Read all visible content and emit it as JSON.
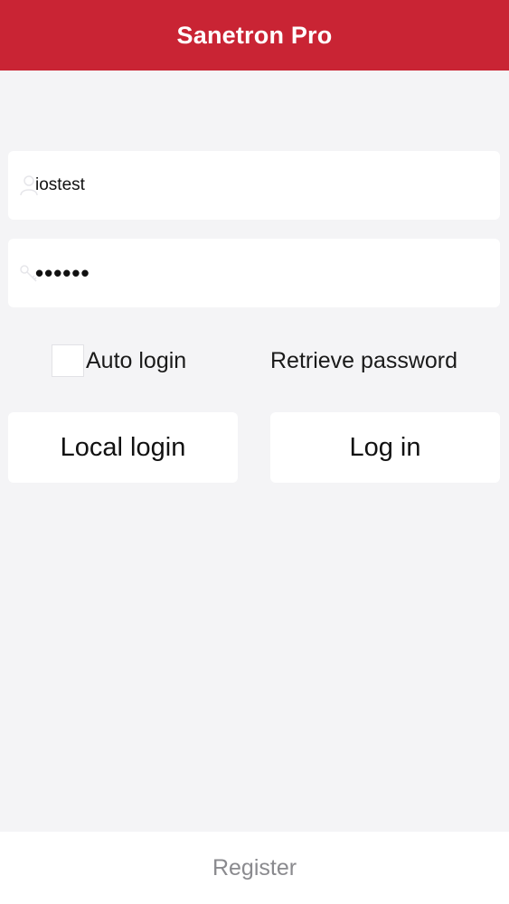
{
  "app": {
    "title": "Sanetron Pro"
  },
  "colors": {
    "header_bg": "#c92434",
    "page_bg": "#f4f4f6",
    "field_bg": "#ffffff",
    "footer_text": "#8a8a8e"
  },
  "login_form": {
    "username": {
      "value": "iostest",
      "icon": "user-icon"
    },
    "password": {
      "masked_value": "••••••",
      "icon": "key-icon"
    },
    "auto_login": {
      "label": "Auto login",
      "checked": false
    },
    "retrieve_password_label": "Retrieve password",
    "local_login_label": "Local login",
    "login_label": "Log in"
  },
  "footer": {
    "register_label": "Register"
  }
}
